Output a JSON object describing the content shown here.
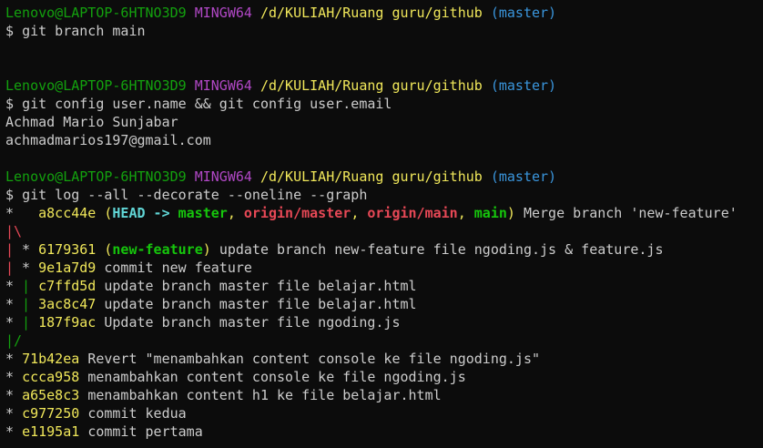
{
  "prompt": {
    "user_host": "Lenovo@LAPTOP-6HTNO3D9",
    "env": "MINGW64",
    "path": "/d/KULIAH/Ruang guru/github",
    "branch": "(master)",
    "symbol": "$"
  },
  "commands": {
    "cmd1": "git branch main",
    "cmd2": "git config user.name && git config user.email",
    "cmd3": "git log --all --decorate --oneline --graph"
  },
  "config_output": {
    "name": "Achmad Mario Sunjabar",
    "email": "achmadmarios197@gmail.com"
  },
  "log": {
    "merge": {
      "graph": "*   ",
      "hash": "a8cc44e",
      "refs_open": "(",
      "head": "HEAD -> ",
      "master": "master",
      "sep1": ", ",
      "origin_master": "origin/master",
      "sep2": ", ",
      "origin_main": "origin/main",
      "sep3": ", ",
      "main": "main",
      "refs_close": ")",
      "message": "Merge branch 'new-feature'"
    },
    "graph_split": "|\\",
    "feature_commits": [
      {
        "graph_a": "|",
        "graph_b": " * ",
        "hash": "6179361",
        "ref": "new-feature",
        "message": "update branch new-feature file ngoding.js & feature.js"
      },
      {
        "graph_a": "|",
        "graph_b": " * ",
        "hash": "9e1a7d9",
        "ref": "",
        "message": "commit new feature"
      }
    ],
    "master_commits": [
      {
        "graph_a": "*",
        "graph_b": " | ",
        "hash": "c7ffd5d",
        "message": "update branch master file belajar.html"
      },
      {
        "graph_a": "*",
        "graph_b": " | ",
        "hash": "3ac8c47",
        "message": "update branch master file belajar.html"
      },
      {
        "graph_a": "*",
        "graph_b": " | ",
        "hash": "187f9ac",
        "message": "Update branch master file ngoding.js"
      }
    ],
    "graph_join": "|/",
    "base_commits": [
      {
        "graph": "* ",
        "hash": "71b42ea",
        "message": "Revert \"menambahkan content console ke file ngoding.js\""
      },
      {
        "graph": "* ",
        "hash": "ccca958",
        "message": "menambahkan content console ke file ngoding.js"
      },
      {
        "graph": "* ",
        "hash": "a65e8c3",
        "message": "menambahkan content h1 ke file belajar.html"
      },
      {
        "graph": "* ",
        "hash": "c977250",
        "message": "commit kedua"
      },
      {
        "graph": "* ",
        "hash": "e1195a1",
        "message": "commit pertama"
      }
    ]
  },
  "colors": {
    "background": "#0c0c0c",
    "user_host": "#13a10e",
    "env": "#b148c6",
    "path": "#f0e75a",
    "branch": "#3a96dd",
    "hash": "#f0e75a",
    "head": "#61d6d6",
    "local_branch": "#16c60c",
    "remote_branch": "#e74856",
    "graph_red": "#e74856",
    "graph_green": "#13a10e"
  }
}
